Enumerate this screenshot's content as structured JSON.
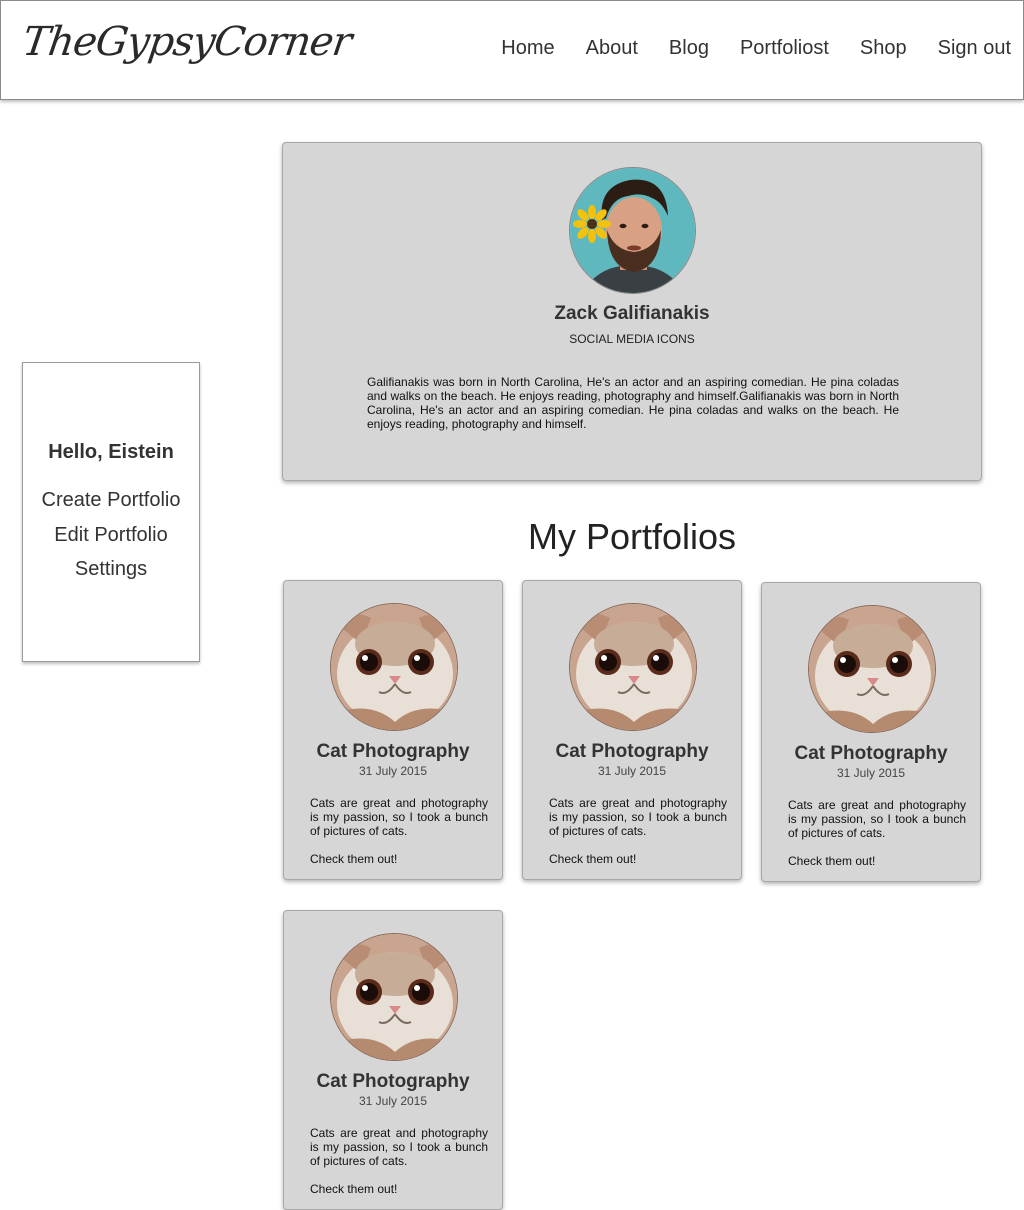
{
  "header": {
    "logo": "TheGypsyCorner",
    "nav": [
      "Home",
      "About",
      "Blog",
      "Portfoliost",
      "Shop",
      "Sign out"
    ]
  },
  "sidebar": {
    "greeting": "Hello, Eistein",
    "links": [
      "Create Portfolio",
      "Edit Portfolio",
      "Settings"
    ]
  },
  "profile": {
    "name": "Zack Galifianakis",
    "subtitle": "SOCIAL MEDIA ICONS",
    "bio": "Galifianakis was born in North Carolina, He's an actor and an aspiring comedian. He pina coladas and walks on the beach. He enjoys reading, photography and himself.Galifianakis was born in North Carolina, He's an actor and an aspiring comedian. He pina coladas and walks on the beach. He enjoys reading, photography and himself."
  },
  "portfolios": {
    "title": "My Portfolios",
    "items": [
      {
        "title": "Cat Photography",
        "date": "31 July 2015",
        "description": "Cats are great and photography is my passion, so I took a bunch of pictures of cats.",
        "cta": "Check them out!"
      },
      {
        "title": "Cat Photography",
        "date": "31 July 2015",
        "description": "Cats are great and photography is my passion, so I took a bunch of pictures of cats.",
        "cta": "Check them out!"
      },
      {
        "title": "Cat Photography",
        "date": "31 July 2015",
        "description": "Cats are great and photography is my passion, so I took a bunch of pictures of cats.",
        "cta": "Check them out!"
      },
      {
        "title": "Cat Photography",
        "date": "31 July 2015",
        "description": "Cats are great and photography is my passion, so I took a bunch of pictures of cats.",
        "cta": "Check them out!"
      }
    ]
  },
  "colors": {
    "card_bg": "#d6d6d6",
    "profile_bg_circle": "#5fb8be",
    "flower": "#f4c20d"
  }
}
